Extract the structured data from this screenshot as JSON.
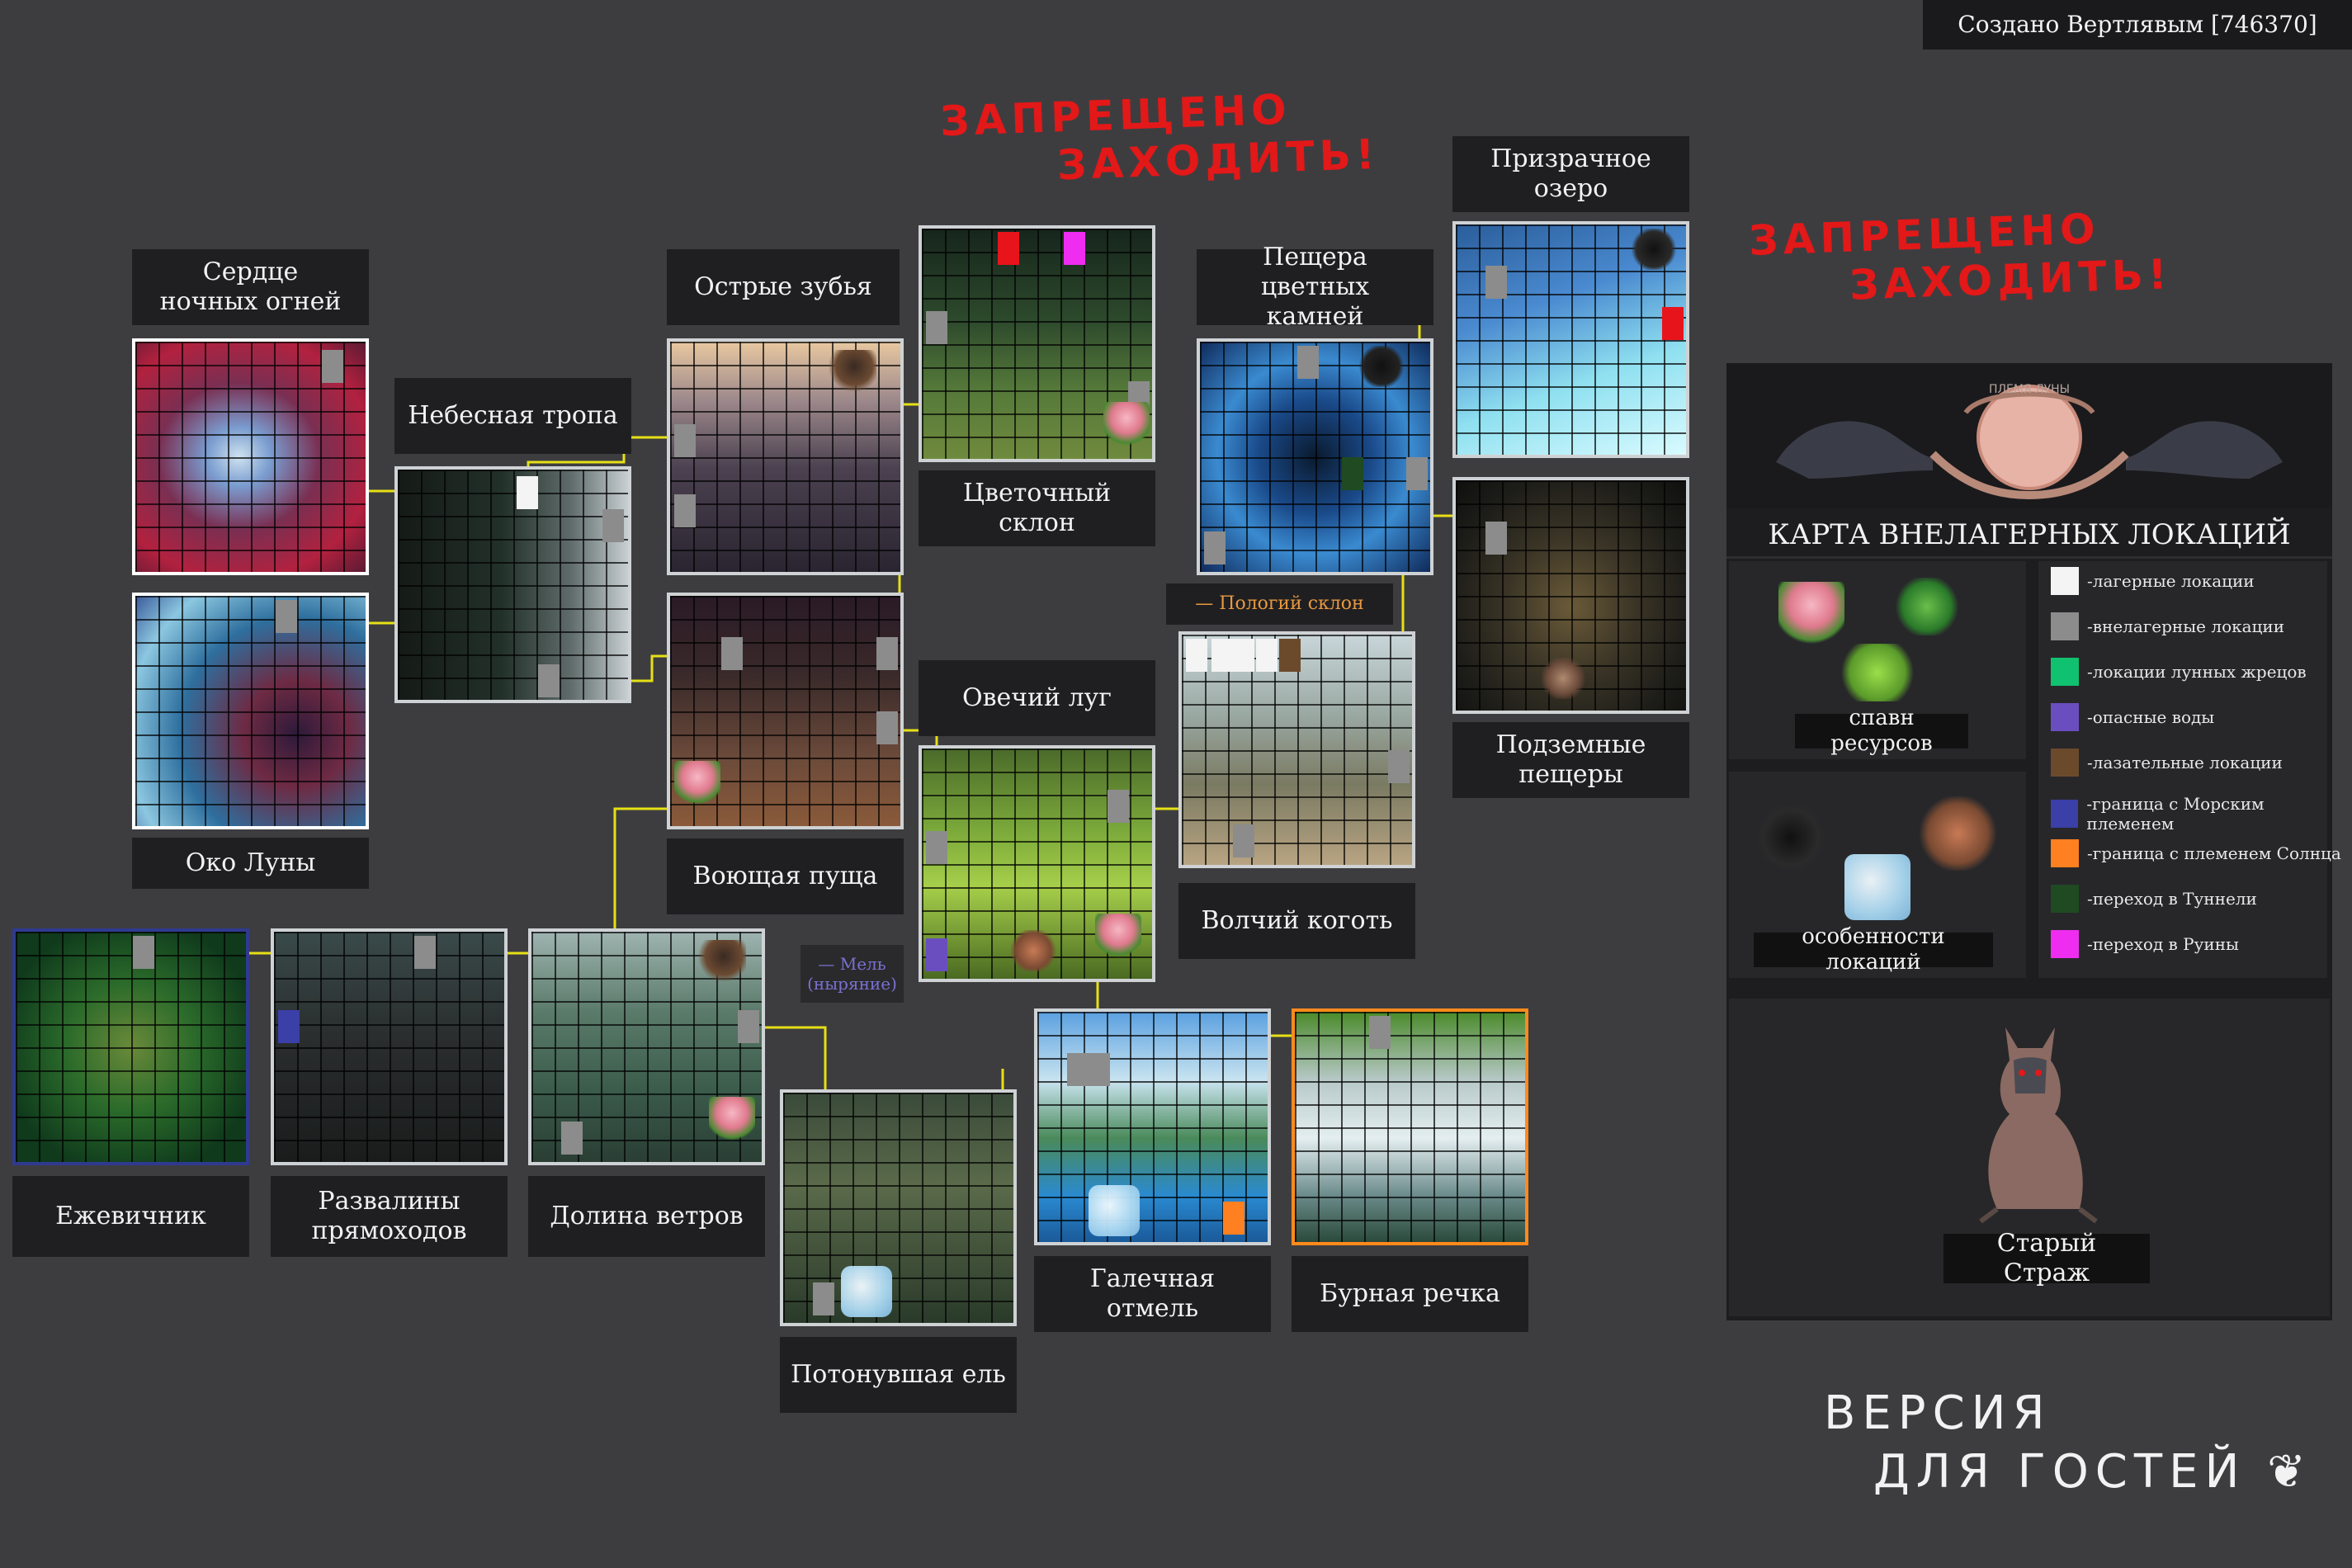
{
  "credit": "Создано Вертлявым [746370]",
  "warnings": {
    "top": [
      "ЗАПРЕЩЕНО",
      "ЗАХОДИТЬ!"
    ],
    "right": [
      "ЗАПРЕЩЕНО",
      "ЗАХОДИТЬ!"
    ]
  },
  "locations": {
    "heart": "Сердце\nночных огней",
    "sky_path": "Небесная тропа",
    "moon_eye": "Око Луны",
    "sharp_teeth": "Острые зубья",
    "flower_slope": "Цветочный\nсклон",
    "colored_cave": "Пещера цветных\nкамней",
    "ghost_lake": "Призрачное\nозеро",
    "underground": "Подземные\nпещеры",
    "howling": "Воющая пуща",
    "sheep_meadow": "Овечий луг",
    "wolf_claw": "Волчий коготь",
    "blackberry": "Ежевичник",
    "ruins": "Развалины\nпрямоходов",
    "wind_valley": "Долина ветров",
    "drowned_fir": "Потонувшая ель",
    "pebble_shoal": "Галечная отмель",
    "stormy_river": "Бурная речка"
  },
  "notes": {
    "gentle_slope": "— Пологий склон",
    "shallow": "— Мель\n(ныряние)"
  },
  "panel": {
    "clan": "ПЛЕМЯ ЛУНЫ",
    "title": "КАРТА ВНЕЛАГЕРНЫХ ЛОКАЦИЙ",
    "spawn": "спавн ресурсов",
    "features": "особенности локаций",
    "guard": "Старый Страж"
  },
  "legend": [
    {
      "color": "#f4f4f4",
      "text": "-лагерные локации"
    },
    {
      "color": "#8c8c8c",
      "text": "-внелагерные локации"
    },
    {
      "color": "#10c270",
      "text": "-локации лунных жрецов"
    },
    {
      "color": "#6a4ec0",
      "text": "-опасные воды"
    },
    {
      "color": "#6b4a2c",
      "text": "-лазательные локации"
    },
    {
      "color": "#3b3fa8",
      "text": "-граница с Морским племенем"
    },
    {
      "color": "#ff8020",
      "text": "-граница с племенем Солнца"
    },
    {
      "color": "#1f4a22",
      "text": "-переход в Туннели"
    },
    {
      "color": "#ef2df0",
      "text": "-переход в Руины"
    }
  ],
  "guest_version": [
    "ВЕРСИЯ",
    "ДЛЯ ГОСТЕЙ ❦"
  ],
  "colors": {
    "bg": "#3d3d40",
    "label_bg": "#1f1f21",
    "wire": "#e6e016",
    "warning": "#e31818"
  }
}
